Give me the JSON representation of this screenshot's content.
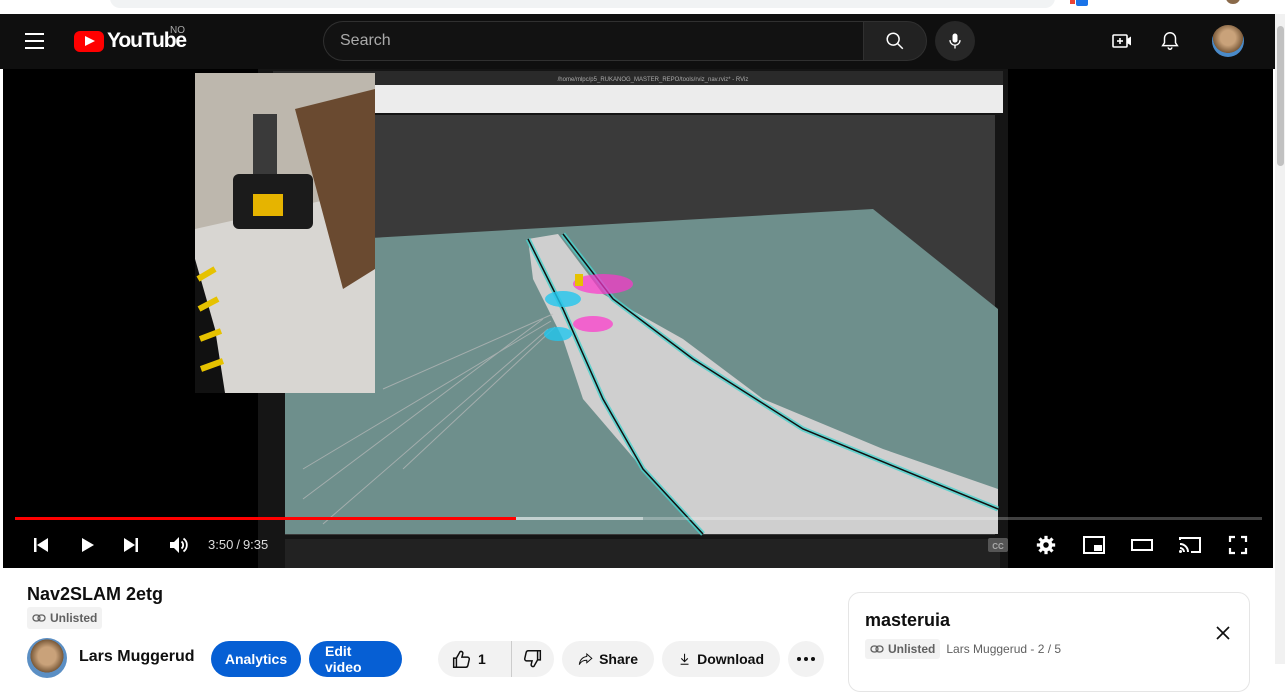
{
  "browser": {},
  "masthead": {
    "logo_text": "YouTube",
    "country_code": "NO",
    "search_placeholder": "Search"
  },
  "player": {
    "current_time": "3:50",
    "separator": "/",
    "duration": "9:35",
    "progress_played": 0.402,
    "progress_buffered": 0.504,
    "screen_window_title": "/home/mlpc/p5_RUKANOG_MASTER_REPO/tools/rviz_nav.rviz* - RViz"
  },
  "video": {
    "title": "Nav2SLAM 2etg",
    "visibility": "Unlisted",
    "channel_name": "Lars Muggerud",
    "analytics_label": "Analytics",
    "edit_label": "Edit video",
    "like_count": "1",
    "share_label": "Share",
    "download_label": "Download"
  },
  "playlist": {
    "title": "masteruia",
    "visibility": "Unlisted",
    "owner_position": "Lars Muggerud - 2 / 5"
  },
  "colors": {
    "brand_red": "#ff0000",
    "primary_blue": "#065fd4",
    "masthead_bg": "#0f0f0f"
  },
  "icons": [
    "menu-icon",
    "youtube-logo",
    "search-icon",
    "mic-icon",
    "create-icon",
    "bell-icon",
    "prev-icon",
    "play-icon",
    "next-icon",
    "volume-icon",
    "subtitles-icon",
    "settings-icon",
    "miniplayer-icon",
    "theater-icon",
    "cast-icon",
    "fullscreen-icon",
    "link-icon",
    "thumbs-up-icon",
    "thumbs-down-icon",
    "share-icon",
    "download-icon",
    "more-icon",
    "close-icon"
  ]
}
